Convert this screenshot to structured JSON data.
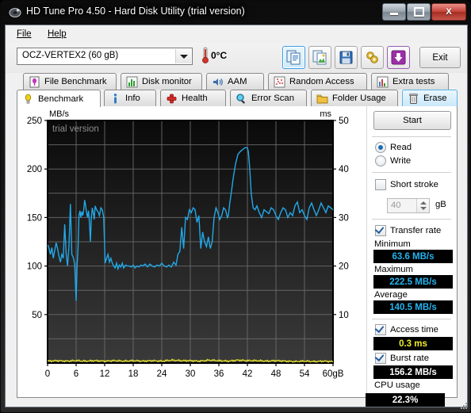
{
  "window": {
    "title": "HD Tune Pro 4.50 - Hard Disk Utility (trial version)",
    "icon": "hdtune-logo-icon",
    "controls": {
      "minimize": "minimize-button",
      "maximize": "maximize-button",
      "close_label": "X"
    }
  },
  "menu": {
    "items": [
      {
        "label": "File",
        "mnemonic": "F"
      },
      {
        "label": "Help",
        "mnemonic": "H"
      }
    ]
  },
  "toolbar": {
    "drive_selected": "OCZ-VERTEX2 (60 gB)",
    "drive_options": [
      "OCZ-VERTEX2 (60 gB)"
    ],
    "temperature": "0°C",
    "thermometer_icon": "thermometer-icon",
    "buttons": [
      {
        "name": "copy-text-button",
        "icon": "copy-text-icon",
        "selected": true
      },
      {
        "name": "copy-image-button",
        "icon": "copy-image-icon",
        "selected": false
      },
      {
        "name": "save-button",
        "icon": "floppy-disk-icon",
        "selected": false
      },
      {
        "name": "settings-button",
        "icon": "gear-icon",
        "selected": false
      },
      {
        "name": "download-button",
        "icon": "down-arrow-icon",
        "selected": false
      }
    ],
    "exit_label": "Exit"
  },
  "tabs": {
    "row1": [
      {
        "label": "File Benchmark",
        "icon": "file-benchmark-icon",
        "state": "normal"
      },
      {
        "label": "Disk monitor",
        "icon": "bar-chart-icon",
        "state": "normal"
      },
      {
        "label": "AAM",
        "icon": "speaker-icon",
        "state": "normal"
      },
      {
        "label": "Random Access",
        "icon": "scatter-icon",
        "state": "normal"
      },
      {
        "label": "Extra tests",
        "icon": "extra-tests-icon",
        "state": "normal"
      }
    ],
    "row2": [
      {
        "label": "Benchmark",
        "icon": "lightbulb-icon",
        "state": "active"
      },
      {
        "label": "Info",
        "icon": "info-icon",
        "state": "normal"
      },
      {
        "label": "Health",
        "icon": "red-cross-icon",
        "state": "normal"
      },
      {
        "label": "Error Scan",
        "icon": "magnifier-icon",
        "state": "normal"
      },
      {
        "label": "Folder Usage",
        "icon": "folder-icon",
        "state": "normal"
      },
      {
        "label": "Erase",
        "icon": "trash-icon",
        "state": "hover"
      }
    ]
  },
  "sidebar": {
    "start_label": "Start",
    "mode": {
      "read_label": "Read",
      "write_label": "Write",
      "selected": "Read"
    },
    "short_stroke": {
      "label": "Short stroke",
      "checked": false,
      "value": "40",
      "unit": "gB"
    },
    "transfer_rate": {
      "label": "Transfer rate",
      "checked": true,
      "minimum_label": "Minimum",
      "minimum_value": "63.6 MB/s",
      "maximum_label": "Maximum",
      "maximum_value": "222.5 MB/s",
      "average_label": "Average",
      "average_value": "140.5 MB/s"
    },
    "access_time": {
      "label": "Access time",
      "checked": true,
      "value": "0.3 ms"
    },
    "burst_rate": {
      "label": "Burst rate",
      "checked": true,
      "value": "156.2 MB/s"
    },
    "cpu_usage": {
      "label": "CPU usage",
      "value": "22.3%"
    }
  },
  "colors": {
    "transfer_line": "#22a8e8",
    "access_dots": "#f2ec2a",
    "plot_bg_top": "#0a0a0a",
    "plot_bg_bottom": "#3a3a3a",
    "grid": "#6e6e6e",
    "value_cyan": "#23b4f0",
    "value_yellow": "#f2ec2a",
    "value_white": "#ffffff"
  },
  "chart_data": {
    "type": "line",
    "title": "",
    "watermark": "trial version",
    "ylabel": "MB/s",
    "ylabel_right": "ms",
    "xlabel": "",
    "xunit": "gB",
    "xlim": [
      0,
      60
    ],
    "ylim": [
      0,
      250
    ],
    "ylim_right": [
      0,
      50
    ],
    "yticks": [
      50,
      100,
      150,
      200,
      250
    ],
    "yticks_right": [
      10,
      20,
      30,
      40,
      50
    ],
    "xticks": [
      0,
      6,
      12,
      18,
      24,
      30,
      36,
      42,
      48,
      54,
      60
    ],
    "xticklabels": [
      "0",
      "6",
      "12",
      "18",
      "24",
      "30",
      "36",
      "42",
      "48",
      "54",
      "60gB"
    ],
    "grid": true,
    "legend": false,
    "series": [
      {
        "name": "Transfer rate",
        "axis": "left",
        "color": "#22a8e8",
        "x": [
          0.0,
          0.3,
          0.6,
          0.9,
          1.2,
          1.5,
          1.8,
          2.1,
          2.4,
          2.7,
          3.0,
          3.3,
          3.6,
          3.9,
          4.2,
          4.5,
          4.8,
          5.1,
          5.4,
          5.7,
          6.0,
          6.2,
          6.4,
          6.6,
          6.8,
          7.0,
          7.2,
          7.4,
          7.6,
          7.8,
          8.0,
          8.2,
          8.4,
          8.6,
          8.8,
          9.0,
          9.2,
          9.4,
          9.6,
          9.8,
          10.0,
          10.3,
          10.6,
          10.9,
          11.2,
          11.5,
          11.8,
          12.1,
          12.4,
          12.7,
          13.0,
          13.3,
          13.6,
          13.9,
          14.2,
          14.5,
          14.8,
          15.1,
          15.4,
          15.7,
          16.0,
          16.4,
          16.8,
          17.2,
          17.6,
          18.0,
          18.4,
          18.8,
          19.2,
          19.6,
          20.0,
          20.5,
          21.0,
          21.5,
          22.0,
          22.5,
          23.0,
          23.5,
          24.0,
          24.5,
          25.0,
          25.5,
          26.0,
          26.5,
          27.0,
          27.4,
          27.8,
          28.2,
          28.6,
          29.0,
          29.4,
          29.8,
          30.2,
          30.6,
          31.0,
          31.4,
          31.8,
          32.2,
          32.6,
          33.0,
          33.4,
          33.8,
          34.2,
          34.6,
          35.0,
          35.4,
          35.8,
          36.2,
          36.6,
          37.0,
          37.4,
          37.8,
          38.0,
          38.3,
          38.6,
          39.0,
          39.5,
          40.0,
          40.5,
          41.0,
          41.5,
          42.0,
          42.2,
          42.5,
          42.8,
          43.2,
          43.6,
          44.0,
          44.5,
          45.0,
          45.5,
          46.0,
          46.5,
          47.0,
          47.5,
          48.0,
          48.5,
          49.0,
          49.5,
          50.0,
          50.5,
          51.0,
          51.5,
          52.0,
          52.5,
          53.0,
          53.5,
          54.0,
          54.5,
          55.0,
          55.5,
          56.0,
          56.5,
          57.0,
          57.5,
          58.0,
          58.5,
          59.0,
          59.5,
          60.0
        ],
        "y": [
          122,
          118,
          112,
          119,
          108,
          116,
          124,
          118,
          110,
          104,
          112,
          108,
          143,
          113,
          100,
          121,
          164,
          112,
          109,
          102,
          64,
          100,
          118,
          152,
          157,
          150,
          156,
          152,
          158,
          168,
          162,
          155,
          150,
          157,
          145,
          125,
          150,
          160,
          155,
          148,
          162,
          158,
          156,
          152,
          160,
          158,
          150,
          103,
          108,
          112,
          104,
          108,
          103,
          100,
          98,
          103,
          97,
          101,
          99,
          103,
          98,
          101,
          100,
          100,
          99,
          101,
          98,
          100,
          99,
          101,
          100,
          102,
          99,
          102,
          100,
          99,
          101,
          100,
          103,
          100,
          99,
          101,
          99,
          104,
          101,
          112,
          115,
          140,
          118,
          150,
          148,
          158,
          155,
          160,
          158,
          145,
          152,
          118,
          135,
          125,
          120,
          130,
          118,
          125,
          150,
          160,
          155,
          148,
          152,
          160,
          158,
          150,
          152,
          165,
          175,
          190,
          205,
          215,
          218,
          220,
          222,
          222,
          218,
          200,
          175,
          160,
          158,
          162,
          155,
          150,
          158,
          156,
          154,
          160,
          158,
          152,
          148,
          155,
          160,
          158,
          150,
          155,
          152,
          162,
          166,
          155,
          158,
          152,
          148,
          160,
          165,
          158,
          152,
          158,
          165,
          160,
          155,
          162,
          160,
          158,
          163
        ]
      },
      {
        "name": "Access time",
        "axis": "right",
        "color": "#f2ec2a",
        "x": [
          0,
          2,
          4,
          6,
          8,
          10,
          12,
          14,
          16,
          18,
          20,
          22,
          24,
          26,
          28,
          30,
          32,
          34,
          36,
          38,
          40,
          42,
          44,
          46,
          48,
          50,
          52,
          54,
          56,
          58,
          60
        ],
        "y": [
          0.4,
          0.5,
          0.4,
          0.5,
          0.4,
          0.5,
          0.4,
          0.5,
          0.4,
          0.5,
          0.4,
          0.5,
          0.4,
          0.6,
          0.5,
          0.5,
          0.4,
          0.6,
          0.5,
          0.4,
          0.6,
          0.5,
          0.5,
          0.4,
          0.5,
          0.4,
          0.3,
          0.4,
          0.3,
          0.4,
          0.3
        ]
      }
    ]
  }
}
